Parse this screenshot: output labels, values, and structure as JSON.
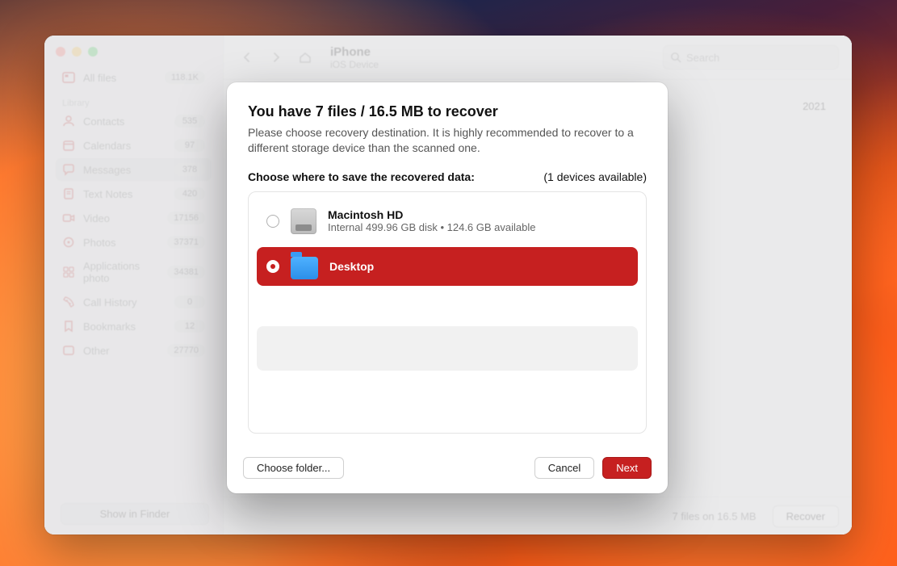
{
  "header": {
    "title": "iPhone",
    "subtitle": "iOS Device",
    "search_placeholder": "Search"
  },
  "sidebar": {
    "all_files": {
      "label": "All files",
      "badge": "118.1K"
    },
    "library_header": "Library",
    "items": [
      {
        "icon": "contacts",
        "label": "Contacts",
        "badge": "535"
      },
      {
        "icon": "calendar",
        "label": "Calendars",
        "badge": "97"
      },
      {
        "icon": "messages",
        "label": "Messages",
        "badge": "378",
        "active": true
      },
      {
        "icon": "notes",
        "label": "Text Notes",
        "badge": "420"
      },
      {
        "icon": "video",
        "label": "Video",
        "badge": "17156"
      },
      {
        "icon": "photos",
        "label": "Photos",
        "badge": "37371"
      },
      {
        "icon": "apps",
        "label": "Applications photo",
        "badge": "34381"
      },
      {
        "icon": "phone",
        "label": "Call History",
        "badge": "0"
      },
      {
        "icon": "bookmark",
        "label": "Bookmarks",
        "badge": "12"
      },
      {
        "icon": "other",
        "label": "Other",
        "badge": "27770"
      }
    ]
  },
  "visible_content": {
    "date_fragment": "2021"
  },
  "footer": {
    "show_in_finder": "Show in Finder",
    "status": "7 files on 16.5 MB",
    "recover": "Recover"
  },
  "modal": {
    "title": "You have 7 files / 16.5 MB to recover",
    "subtitle": "Please choose recovery destination. It is highly recommended to recover to a different storage device than the scanned one.",
    "choose_label": "Choose where to save the recovered data:",
    "devices_available": "(1 devices available)",
    "devices": [
      {
        "selected": false,
        "icon": "hdd",
        "name": "Macintosh HD",
        "detail": "Internal 499.96 GB disk • 124.6 GB available"
      },
      {
        "selected": true,
        "icon": "folder",
        "name": "Desktop",
        "detail": ""
      }
    ],
    "buttons": {
      "choose_folder": "Choose folder...",
      "cancel": "Cancel",
      "next": "Next"
    }
  }
}
